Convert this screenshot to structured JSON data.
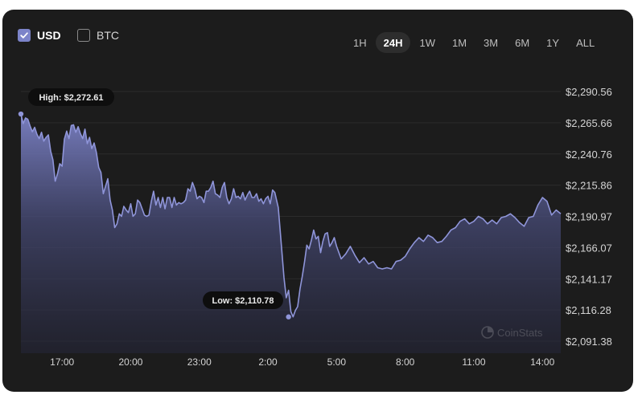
{
  "toggles": [
    {
      "label": "USD",
      "checked": true
    },
    {
      "label": "BTC",
      "checked": false
    }
  ],
  "ranges": [
    "1H",
    "24H",
    "1W",
    "1M",
    "3M",
    "6M",
    "1Y",
    "ALL"
  ],
  "active_range": "24H",
  "watermark": "CoinStats",
  "colors": {
    "line": "#8f95d9",
    "background": "#1c1c1c",
    "active_pill": "#2d2d2d"
  },
  "chart_data": {
    "type": "area",
    "xlabel": "",
    "ylabel": "",
    "x_range_hours": [
      15.2,
      14.8
    ],
    "x_ticks": [
      {
        "label": "17:00",
        "t": 17
      },
      {
        "label": "20:00",
        "t": 20
      },
      {
        "label": "23:00",
        "t": 23
      },
      {
        "label": "2:00",
        "t": 26
      },
      {
        "label": "5:00",
        "t": 29
      },
      {
        "label": "8:00",
        "t": 32
      },
      {
        "label": "11:00",
        "t": 35
      },
      {
        "label": "14:00",
        "t": 38
      }
    ],
    "y_ticks": [
      "$2,290.56",
      "$2,265.66",
      "$2,240.76",
      "$2,215.86",
      "$2,190.97",
      "$2,166.07",
      "$2,141.17",
      "$2,116.28",
      "$2,091.38"
    ],
    "ylim": [
      2091.38,
      2290.56
    ],
    "grid": true,
    "high": {
      "label": "High: $2,272.61",
      "value": 2272.61,
      "t": 15.2
    },
    "low": {
      "label": "Low: $2,110.78",
      "value": 2110.78,
      "t": 26.9
    },
    "series": [
      {
        "t": [
          15.2,
          15.3,
          15.4,
          15.5,
          15.6,
          15.7,
          15.8,
          15.9,
          16.0,
          16.1,
          16.2,
          16.3,
          16.4,
          16.5,
          16.6,
          16.7,
          16.8,
          16.9,
          17.0,
          17.1,
          17.2,
          17.3,
          17.4,
          17.5,
          17.6,
          17.7,
          17.8,
          17.9,
          18.0,
          18.1,
          18.2,
          18.3,
          18.4,
          18.5,
          18.6,
          18.7,
          18.8,
          18.9,
          19.0,
          19.1,
          19.2,
          19.3,
          19.4,
          19.5,
          19.6,
          19.7,
          19.8,
          19.9,
          20.0,
          20.1,
          20.2,
          20.3,
          20.4,
          20.5,
          20.6,
          20.7,
          20.8,
          20.9,
          21.0,
          21.1,
          21.2,
          21.3,
          21.4,
          21.5,
          21.6,
          21.7,
          21.8,
          21.9,
          22.0,
          22.1,
          22.2,
          22.3,
          22.4,
          22.5,
          22.6,
          22.7,
          22.8,
          22.9,
          23.0,
          23.1,
          23.2,
          23.3,
          23.4,
          23.5,
          23.6,
          23.7,
          23.8,
          23.9,
          24.0,
          24.1,
          24.2,
          24.3,
          24.4,
          24.5,
          24.6,
          24.7,
          24.8,
          24.9,
          25.0,
          25.1,
          25.2,
          25.3,
          25.4,
          25.5,
          25.6,
          25.7,
          25.8,
          25.9,
          26.0,
          26.1,
          26.2,
          26.3,
          26.45,
          26.6,
          26.7,
          26.8,
          26.9,
          27.0,
          27.1,
          27.2,
          27.3,
          27.4,
          27.5,
          27.6,
          27.7,
          27.8,
          27.9,
          28.0,
          28.1,
          28.2,
          28.3,
          28.4,
          28.5,
          28.6,
          28.7,
          28.8,
          28.9,
          29.0,
          29.2,
          29.4,
          29.6,
          29.8,
          30.0,
          30.2,
          30.4,
          30.6,
          30.8,
          31.0,
          31.2,
          31.4,
          31.6,
          31.8,
          32.0,
          32.2,
          32.4,
          32.6,
          32.8,
          33.0,
          33.2,
          33.4,
          33.6,
          33.8,
          34.0,
          34.2,
          34.4,
          34.6,
          34.8,
          35.0,
          35.2,
          35.4,
          35.6,
          35.8,
          36.0,
          36.2,
          36.4,
          36.6,
          36.8,
          37.0,
          37.2,
          37.4,
          37.6,
          37.8,
          38.0,
          38.2,
          38.4,
          38.6,
          38.8
        ],
        "values": [
          2272.6,
          2265.0,
          2269.5,
          2268.5,
          2263.0,
          2258.5,
          2262.0,
          2256.5,
          2253.0,
          2258.0,
          2251.0,
          2254.0,
          2256.0,
          2243.0,
          2236.0,
          2219.0,
          2225.0,
          2233.0,
          2231.0,
          2252.5,
          2259.0,
          2253.0,
          2263.5,
          2264.0,
          2258.0,
          2262.5,
          2257.0,
          2253.0,
          2260.5,
          2249.0,
          2254.0,
          2245.0,
          2249.5,
          2242.0,
          2230.0,
          2226.0,
          2209.0,
          2215.0,
          2221.0,
          2204.0,
          2196.0,
          2182.0,
          2185.0,
          2193.0,
          2191.0,
          2199.0,
          2196.0,
          2194.0,
          2201.0,
          2191.0,
          2193.0,
          2204.0,
          2202.0,
          2197.0,
          2192.0,
          2191.0,
          2192.0,
          2203.0,
          2211.0,
          2200.0,
          2206.0,
          2198.0,
          2206.0,
          2197.0,
          2206.0,
          2206.0,
          2198.0,
          2206.0,
          2200.0,
          2202.0,
          2201.0,
          2202.0,
          2204.0,
          2213.0,
          2211.0,
          2218.0,
          2213.0,
          2205.0,
          2207.0,
          2206.0,
          2202.0,
          2211.0,
          2211.0,
          2214.0,
          2219.0,
          2209.0,
          2208.0,
          2206.0,
          2214.0,
          2218.0,
          2206.0,
          2201.0,
          2205.0,
          2213.0,
          2206.0,
          2207.0,
          2205.0,
          2210.0,
          2204.0,
          2208.0,
          2211.0,
          2206.0,
          2206.0,
          2209.0,
          2203.0,
          2205.0,
          2201.0,
          2205.0,
          2207.0,
          2201.0,
          2212.0,
          2210.0,
          2198.0,
          2165.0,
          2142.0,
          2126.0,
          2132.0,
          2115.0,
          2110.8,
          2116.0,
          2119.0,
          2133.0,
          2143.0,
          2155.0,
          2168.0,
          2165.0,
          2172.0,
          2180.0,
          2173.0,
          2175.0,
          2162.0,
          2171.0,
          2177.0,
          2178.0,
          2167.0,
          2170.0,
          2174.0,
          2167.0,
          2157.0,
          2161.0,
          2167.0,
          2160.0,
          2154.0,
          2158.0,
          2153.0,
          2155.0,
          2150.0,
          2149.0,
          2150.0,
          2149.0,
          2155.0,
          2156.0,
          2159.0,
          2165.0,
          2170.0,
          2174.0,
          2171.0,
          2176.0,
          2174.0,
          2170.0,
          2171.0,
          2175.0,
          2180.0,
          2182.0,
          2187.0,
          2189.0,
          2185.0,
          2187.0,
          2191.0,
          2189.0,
          2185.0,
          2188.0,
          2185.0,
          2190.0,
          2191.0,
          2193.0,
          2190.0,
          2186.0,
          2183.0,
          2190.0,
          2191.0,
          2200.0,
          2206.0,
          2203.0,
          2192.0,
          2196.0,
          2193.0,
          2191.0,
          2192.0,
          2197.0,
          2203.0,
          2195.0,
          2197.0,
          2193.0,
          2181.0,
          2175.0
        ]
      }
    ]
  }
}
